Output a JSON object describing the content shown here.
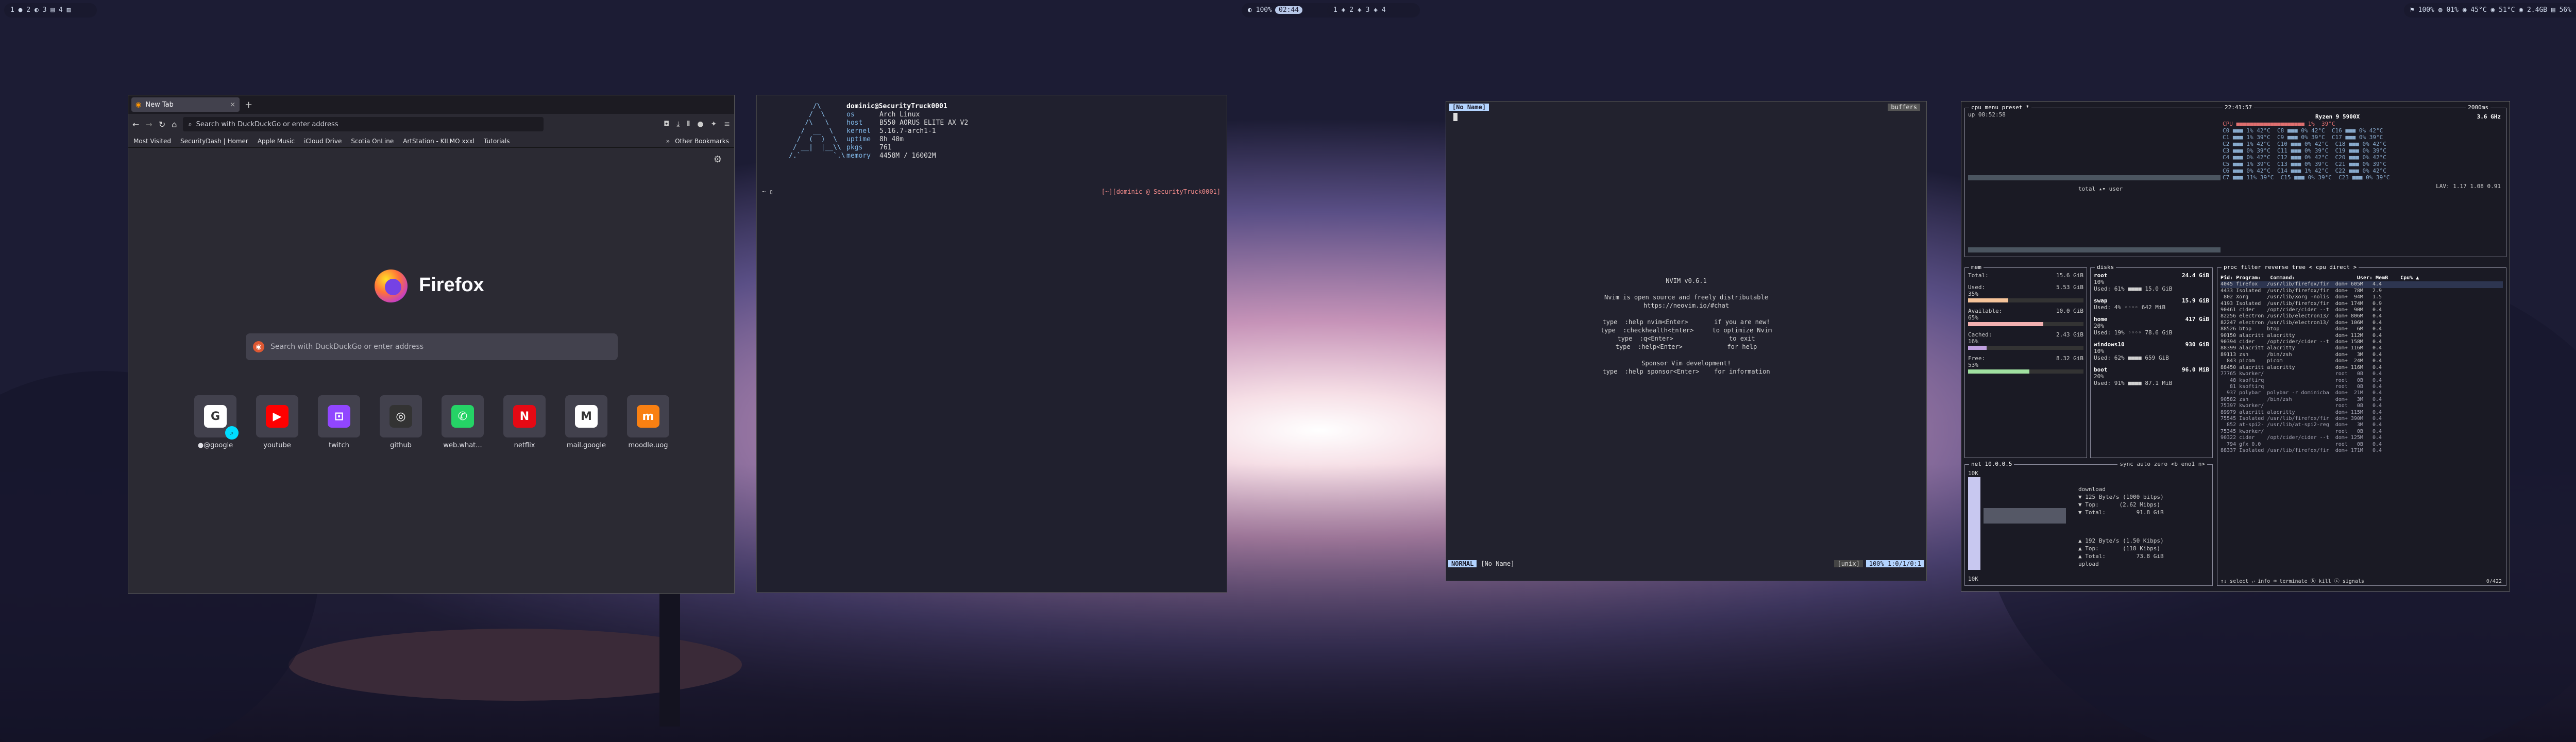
{
  "bar_left": {
    "workspaces": "1 ● 2 ◐ 3 ▤ 4 ▨"
  },
  "bar_center_left": {
    "text": "◐ 100%",
    "chip": "02:44"
  },
  "bar_center_right": {
    "text": "1 ◈ 2 ◈ 3 ◈ 4"
  },
  "bar_right": {
    "text": "⚑ 100%  ◍ 01%  ◉ 45°C  ◉ 51°C  ◉ 2.4GB  ▤ 56%"
  },
  "firefox": {
    "tab_label": "New Tab",
    "tab_close": "×",
    "new_tab": "+",
    "url_placeholder": "Search with DuckDuckGo or enter address",
    "bookmarks": [
      "Most Visited",
      "SecurityDash | Homer",
      "Apple Music",
      "iCloud Drive",
      "Scotia OnLine",
      "ArtStation - KILMO xxxl",
      "Tutorials"
    ],
    "other_bookmarks": "Other Bookmarks",
    "brand": "Firefox",
    "search_placeholder": "Search with DuckDuckGo or enter address",
    "shortcuts": [
      {
        "label": "●@google",
        "glyph": "G",
        "color": "#ffffff"
      },
      {
        "label": "youtube",
        "glyph": "▶",
        "color": "#ff0000"
      },
      {
        "label": "twitch",
        "glyph": "⊡",
        "color": "#9146ff"
      },
      {
        "label": "github",
        "glyph": "◎",
        "color": "#333333"
      },
      {
        "label": "web.what...",
        "glyph": "✆",
        "color": "#25d366"
      },
      {
        "label": "netflix",
        "glyph": "N",
        "color": "#e50914"
      },
      {
        "label": "mail.google",
        "glyph": "M",
        "color": "#ffffff"
      },
      {
        "label": "moodle.uog",
        "glyph": "m",
        "color": "#f98012"
      }
    ]
  },
  "neofetch": {
    "user": "dominic@SecurityTruck0001",
    "rows": [
      {
        "k": "os",
        "v": "Arch Linux"
      },
      {
        "k": "host",
        "v": "B550 AORUS ELITE AX V2"
      },
      {
        "k": "kernel",
        "v": "5.16.7-arch1-1"
      },
      {
        "k": "uptime",
        "v": "8h 40m"
      },
      {
        "k": "pkgs",
        "v": "761"
      },
      {
        "k": "memory",
        "v": "4458M / 16002M"
      }
    ],
    "prompt_left": "~ ▯",
    "prompt_right": "[~][dominic @ SecurityTruck0001]"
  },
  "nvim": {
    "tab_label": "[No Name]",
    "buffers_label": "buffers",
    "intro": "NVIM v0.6.1\n\nNvim is open source and freely distributable\nhttps://neovim.io/#chat\n\ntype  :help nvim<Enter>       if you are new!\ntype  :checkhealth<Enter>     to optimize Nvim\ntype  :q<Enter>               to exit\ntype  :help<Enter>            for help\n\nSponsor Vim development!\ntype  :help sponsor<Enter>    for information",
    "mode": "NORMAL",
    "file": "[No Name]",
    "fileformat": "[unix]",
    "position": "100% 1:0/1/0:1"
  },
  "btop": {
    "cpu_title": "cpu",
    "cpu_header": "menu  preset *",
    "time": "22:41:57",
    "interval": "2000ms",
    "uptime": "up 08:52:58",
    "cpu_model": "Ryzen 9 5900X",
    "freq": "3.6 GHz",
    "cpu_total": "CPU ■■■■■■■■■■■■■■■■■■■■ 1%  39°C",
    "cores": [
      "C0 ■■■ 1% 42°C  C8 ■■■ 0% 42°C  C16 ■■■ 0% 42°C",
      "C1 ■■■ 1% 39°C  C9 ■■■ 0% 39°C  C17 ■■■ 0% 39°C",
      "C2 ■■■ 1% 42°C  C10 ■■■ 0% 42°C  C18 ■■■ 0% 42°C",
      "C3 ■■■ 0% 39°C  C11 ■■■ 0% 39°C  C19 ■■■ 0% 39°C",
      "C4 ■■■ 0% 42°C  C12 ■■■ 0% 42°C  C20 ■■■ 0% 42°C",
      "C5 ■■■ 1% 39°C  C13 ■■■ 0% 39°C  C21 ■■■ 0% 39°C",
      "C6 ■■■ 0% 42°C  C14 ■■■ 1% 42°C  C22 ■■■ 0% 42°C",
      "C7 ■■■ 11% 39°C  C15 ■■■ 0% 39°C  C23 ■■■ 0% 39°C"
    ],
    "load_avg": "LAV: 1.17 1.08 0.91",
    "total_label": "total ▴▾ user",
    "mem_title": "mem",
    "mem_rows": [
      {
        "label": "Total:",
        "value": "15.6 GiB"
      },
      {
        "label": "Used:",
        "value": "5.53 GiB",
        "pct": "35%",
        "color": "#f6c49a",
        "fill": 0.35
      },
      {
        "label": "Available:",
        "value": "10.0 GiB",
        "pct": "65%",
        "color": "#f2b0b0",
        "fill": 0.65
      },
      {
        "label": "Cached:",
        "value": "2.43 GiB",
        "pct": "16%",
        "color": "#c0a0e0",
        "fill": 0.16
      },
      {
        "label": "Free:",
        "value": "8.32 GiB",
        "pct": "53%",
        "color": "#a0e0a0",
        "fill": 0.53
      }
    ],
    "disks_title": "disks",
    "disks": [
      {
        "name": "root",
        "size": "24.4 GiB",
        "pct": "10%",
        "used": "Used: 61% ■■■■ 15.0 GiB"
      },
      {
        "name": "swap",
        "size": "15.9 GiB",
        "pct": "",
        "used": "Used: 4% ◦◦◦◦ 642 MiB"
      },
      {
        "name": "home",
        "size": "417 GiB",
        "pct": "20%",
        "used": "Used: 19% ◦◦◦◦ 78.6 GiB"
      },
      {
        "name": "windows10",
        "size": "930 GiB",
        "pct": "10%",
        "used": "Used: 62% ■■■■ 659 GiB"
      },
      {
        "name": "boot",
        "size": "96.0 MiB",
        "pct": "20%",
        "used": "Used: 91% ■■■■ 87.1 MiB"
      }
    ],
    "net_title": "net",
    "net_ip": "10.0.0.5",
    "net_controls": "sync auto zero <b eno1 n>",
    "net_scale_top": "10K",
    "net_scale_bottom": "10K",
    "net_download": [
      "download",
      "▼ 125 Byte/s (1000 bitps)",
      "▼ Top:      (2.62 Mibps)",
      "▼ Total:         91.8 GiB"
    ],
    "net_upload": [
      "▲ 192 Byte/s (1.50 Kibps)",
      "▲ Top:       (118 Kibps)",
      "▲ Total:         73.8 GiB",
      "upload"
    ],
    "proc_title": "proc",
    "proc_header": "filter   reverse tree < cpu direct >",
    "proc_cols": "Pid: Program:   Command:                    User: MemB    Cpu% ▲",
    "procs": [
      "4045 firefox   /usr/lib/firefox/fir  dom+ 605M   4.4",
      "4433 Isolated  /usr/lib/firefox/fir  dom+  78M   2.9",
      " 802 Xorg      /usr/lib/Xorg -nolis  dom+  94M   1.5",
      "4193 Isolated  /usr/lib/firefox/fir  dom+ 174M   0.9",
      "90461 cider    /opt/cider/cider --t  dom+  90M   0.4",
      "82256 electron /usr/lib/electron13/  dom+ 806M   0.4",
      "82247 electron /usr/lib/electron13/  dom+ 106M   0.4",
      "88526 btop     btop                  dom+   6M   0.4",
      "90150 alacritt alacritty             dom+ 112M   0.4",
      "90394 cider    /opt/cider/cider --t  dom+ 158M   0.4",
      "88399 alacritt alacritty             dom+ 116M   0.4",
      "89113 zsh      /bin/zsh              dom+   3M   0.4",
      "  843 picom    picom                 dom+  24M   0.4",
      "88450 alacritt alacritty             dom+ 116M   0.4",
      "77765 kworker/                       root   0B   0.4",
      "   48 ksoftirq                       root   0B   0.4",
      "   81 ksoftirq                       root   0B   0.4",
      "  937 polybar  polybar -r dominicba  dom+  21M   0.4",
      "90582 zsh      /bin/zsh              dom+   3M   0.4",
      "75397 kworker/                       root   0B   0.4",
      "89979 alacritt alacritty             dom+ 115M   0.4",
      "75545 Isolated /usr/lib/firefox/fir  dom+ 390M   0.4",
      "  852 at-spi2- /usr/lib/at-spi2-reg  dom+   3M   0.4",
      "75345 kworker/                       root   0B   0.4",
      "90322 cider    /opt/cider/cider --t  dom+ 125M   0.4",
      "  794 gfx_0.0                        root   0B   0.4",
      "88337 Isolated /usr/lib/firefox/fir  dom+ 171M   0.4"
    ],
    "proc_footer": "↑↓ select ↵ info ⌫ terminate ⓚ kill ⓢ signals",
    "proc_count": "0/422"
  }
}
